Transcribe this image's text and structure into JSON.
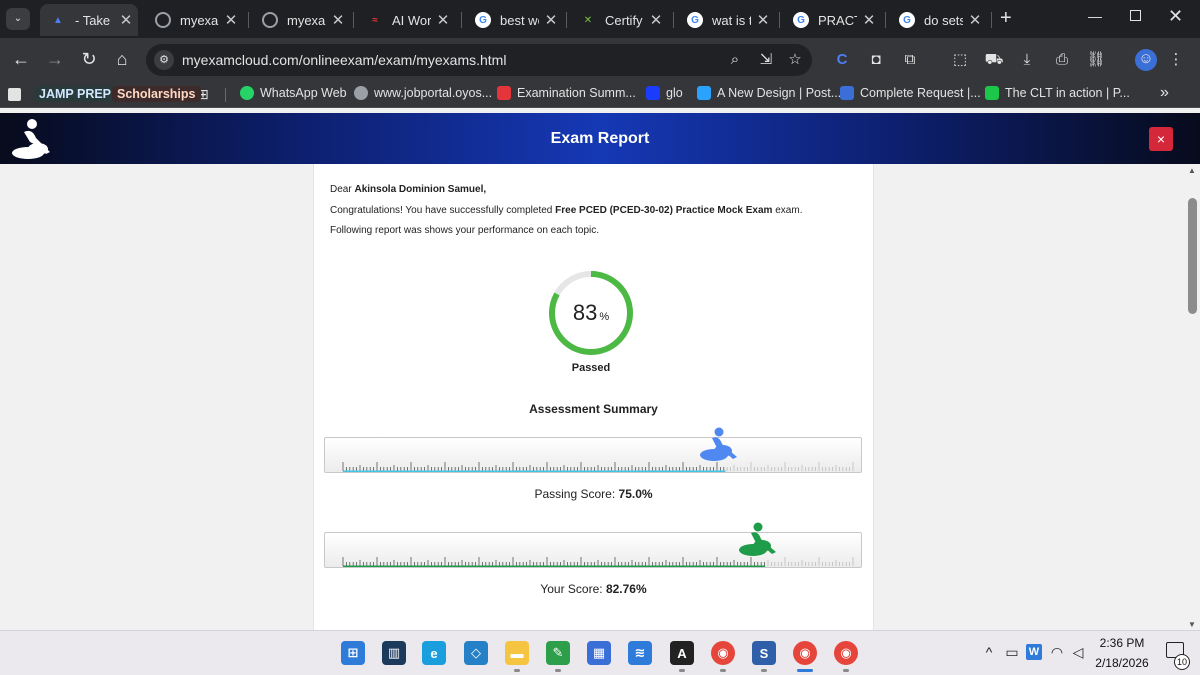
{
  "browser": {
    "tabs": [
      {
        "title": "- Take E",
        "icon": "examcloud-icon",
        "color": "#4d7cf5",
        "active": true
      },
      {
        "title": "myexam",
        "icon": "globe-icon",
        "color": "#9aa0a6"
      },
      {
        "title": "myexam",
        "icon": "globe-icon",
        "color": "#9aa0a6"
      },
      {
        "title": "AI Work",
        "icon": "ai-icon",
        "color": "#e5353c"
      },
      {
        "title": "best we",
        "icon": "google-icon",
        "color": "#ffffff"
      },
      {
        "title": "Certify",
        "icon": "certify-icon",
        "color": "#7cc142"
      },
      {
        "title": "wat is th",
        "icon": "google-icon",
        "color": "#ffffff"
      },
      {
        "title": "PRACTIS",
        "icon": "google-icon",
        "color": "#ffffff"
      },
      {
        "title": "do sets",
        "icon": "google-icon",
        "color": "#ffffff"
      }
    ],
    "new_tab": "+",
    "url": "myexamcloud.com/onlineexam/exam/myexams.html",
    "bookmarks": [
      {
        "label": "JAMP PREP",
        "color": "#9ec5ff"
      },
      {
        "label": "Scholarships",
        "color": "#ffb98a"
      },
      {
        "label": "WhatsApp Web",
        "color": "#25d366"
      },
      {
        "label": "www.jobportal.oyos...",
        "color": "#9aa0a6"
      },
      {
        "label": "Examination Summ...",
        "color": "#e5353c"
      },
      {
        "label": "glo",
        "color": "#1a3cff"
      },
      {
        "label": "A New Design | Post...",
        "color": "#2aa3ff"
      },
      {
        "label": "Complete Request |...",
        "color": "#3b6fd8"
      },
      {
        "label": "The CLT in action | P...",
        "color": "#1bc84a"
      }
    ],
    "more_bookmarks": "»"
  },
  "page": {
    "title": "Exam Report",
    "close_label": "×",
    "greeting_prefix": "Dear",
    "name": "Akinsola Dominion Samuel,",
    "congrats_prefix": "Congratulations! You have successfully completed",
    "exam_name": "Free PCED (PCED-30-02) Practice Mock Exam",
    "congrats_suffix": "exam.",
    "report_note": "Following report was shows your performance on each topic.",
    "score_value": "83",
    "score_unit": "%",
    "score_fraction": 0.83,
    "status": "Passed",
    "summary_title": "Assessment Summary",
    "passing_label": "Passing Score:",
    "passing_value": "75.0%",
    "passing_fraction": 0.75,
    "your_label": "Your Score:",
    "your_value": "82.76%",
    "your_fraction": 0.8276,
    "colors": {
      "ring": "#4cb944",
      "passing_track": "#41c6e8",
      "passing_marker": "#4e88f0",
      "your_track": "#1f9c4a",
      "your_marker": "#1f9c4a"
    }
  },
  "taskbar": {
    "apps": [
      {
        "name": "start-icon",
        "label": "⊞",
        "color": "#2f7bd9"
      },
      {
        "name": "widgets-icon",
        "label": "▥",
        "color": "#1c3a5c"
      },
      {
        "name": "edge-icon",
        "label": "e",
        "color": "#1b9ede"
      },
      {
        "name": "vscode-icon",
        "label": "◇",
        "color": "#2580c8"
      },
      {
        "name": "file-explorer-icon",
        "label": "▬",
        "color": "#f5c542"
      },
      {
        "name": "sketch-app-icon",
        "label": "✎",
        "color": "#2d9e4a"
      },
      {
        "name": "store-icon",
        "label": "▦",
        "color": "#3b6fd8"
      },
      {
        "name": "stack-icon",
        "label": "≋",
        "color": "#2f7bd9"
      },
      {
        "name": "arc-icon",
        "label": "A",
        "color": "#222222"
      },
      {
        "name": "chrome-icon",
        "label": "◉",
        "color": "#e5453a"
      },
      {
        "name": "s-app-icon",
        "label": "S",
        "color": "#2f5fa8"
      },
      {
        "name": "chrome-profile-icon",
        "label": "◉",
        "color": "#e5453a"
      },
      {
        "name": "chrome-profile-e-icon",
        "label": "◉",
        "color": "#e5453a"
      }
    ],
    "time": "2:36 PM",
    "date": "2/18/2026",
    "notifications": "10"
  }
}
